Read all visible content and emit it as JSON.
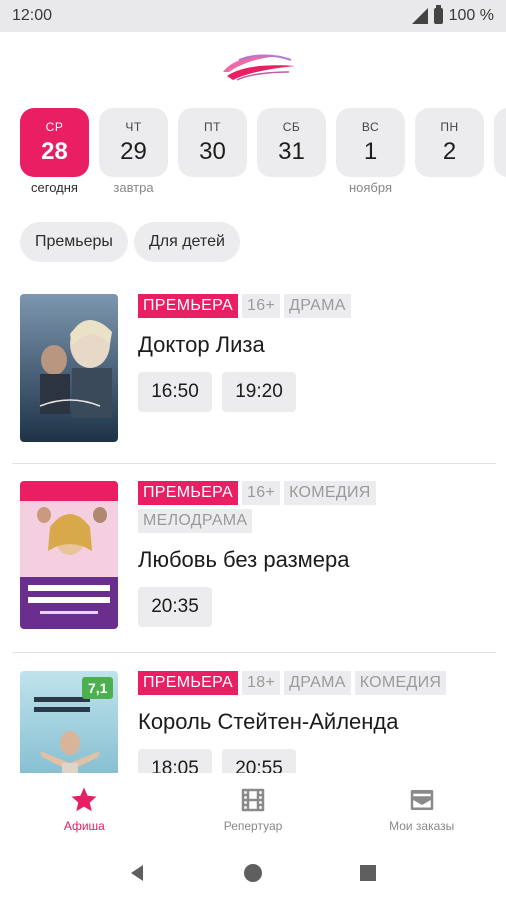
{
  "status_bar": {
    "time": "12:00",
    "battery": "100 %"
  },
  "dates": [
    {
      "dow": "СР",
      "day": "28",
      "caption": "сегодня",
      "active": true
    },
    {
      "dow": "ЧТ",
      "day": "29",
      "caption": "завтра"
    },
    {
      "dow": "ПТ",
      "day": "30",
      "caption": ""
    },
    {
      "dow": "СБ",
      "day": "31",
      "caption": ""
    },
    {
      "dow": "ВС",
      "day": "1",
      "caption": "ноября"
    },
    {
      "dow": "ПН",
      "day": "2",
      "caption": ""
    }
  ],
  "filters": [
    "Премьеры",
    "Для детей"
  ],
  "movies": [
    {
      "tags": [
        "ПРЕМЬЕРА",
        "16+",
        "ДРАМА"
      ],
      "title": "Доктор Лиза",
      "times": [
        "16:50",
        "19:20"
      ]
    },
    {
      "tags": [
        "ПРЕМЬЕРА",
        "16+",
        "КОМЕДИЯ",
        "МЕЛОДРАМА"
      ],
      "title": "Любовь без размера",
      "times": [
        "20:35"
      ]
    },
    {
      "tags": [
        "ПРЕМЬЕРА",
        "18+",
        "ДРАМА",
        "КОМЕДИЯ"
      ],
      "title": "Король Стейтен-Айленда",
      "times": [
        "18:05",
        "20:55"
      ],
      "rating": "7,1"
    }
  ],
  "bottom_nav": {
    "afisha": "Афиша",
    "repertoire": "Репертуар",
    "orders": "Мои заказы"
  },
  "colors": {
    "accent": "#e91e63",
    "chip_bg": "#ececee"
  },
  "icons": [
    "signal-icon",
    "battery-icon",
    "star-icon",
    "film-icon",
    "tickets-icon",
    "back-icon",
    "home-icon",
    "recents-icon"
  ]
}
